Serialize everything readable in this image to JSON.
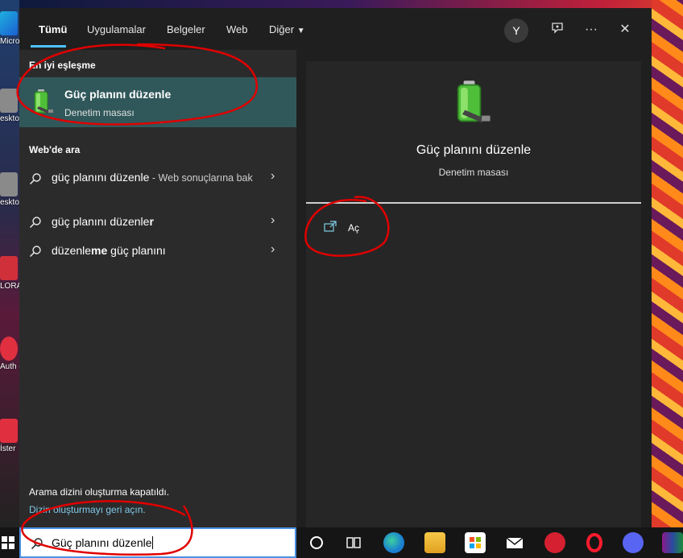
{
  "tabs": [
    {
      "label": "Tümü"
    },
    {
      "label": "Uygulamalar"
    },
    {
      "label": "Belgeler"
    },
    {
      "label": "Web"
    },
    {
      "label": "Diğer"
    }
  ],
  "header": {
    "avatar_letter": "Y",
    "icons": [
      "feedback-icon",
      "more-icon",
      "close-icon"
    ]
  },
  "best_match": {
    "section_label": "En iyi eşleşme",
    "title": "Güç planını düzenle",
    "subtitle": "Denetim masası"
  },
  "web": {
    "section_label": "Web'de ara",
    "items": [
      {
        "prefix": "güç planını düzenle",
        "bold": "",
        "hint": " - Web sonuçlarına bak"
      },
      {
        "prefix": "güç planını düzenle",
        "bold": "r",
        "hint": ""
      },
      {
        "prefix": "düzenle",
        "bold": "me",
        "suffix": " güç planını",
        "hint": ""
      }
    ]
  },
  "footer": {
    "note": "Arama dizini oluşturma kapatıldı.",
    "link": "Dizin oluşturmayı geri açın."
  },
  "detail": {
    "title": "Güç planını düzenle",
    "subtitle": "Denetim masası",
    "action_label": "Aç"
  },
  "desktop_icons": [
    {
      "label": "Micros Edge"
    },
    {
      "label": "esktop"
    },
    {
      "label": "esktop"
    },
    {
      "label": "LORA"
    },
    {
      "label": "Auth esktop"
    },
    {
      "label": "İster"
    }
  ],
  "search_box": {
    "value": "Güç planını düzenle"
  },
  "taskbar_icons": [
    "cortana-icon",
    "task-view-icon",
    "edge-icon",
    "file-explorer-icon",
    "store-icon",
    "mail-icon",
    "app-icon",
    "opera-icon",
    "discord-icon",
    "winrar-icon"
  ],
  "colors": {
    "accent": "#4cc2ff",
    "selected_row": "#30585a",
    "link": "#7fc9e8",
    "annotation": "#e00000"
  }
}
